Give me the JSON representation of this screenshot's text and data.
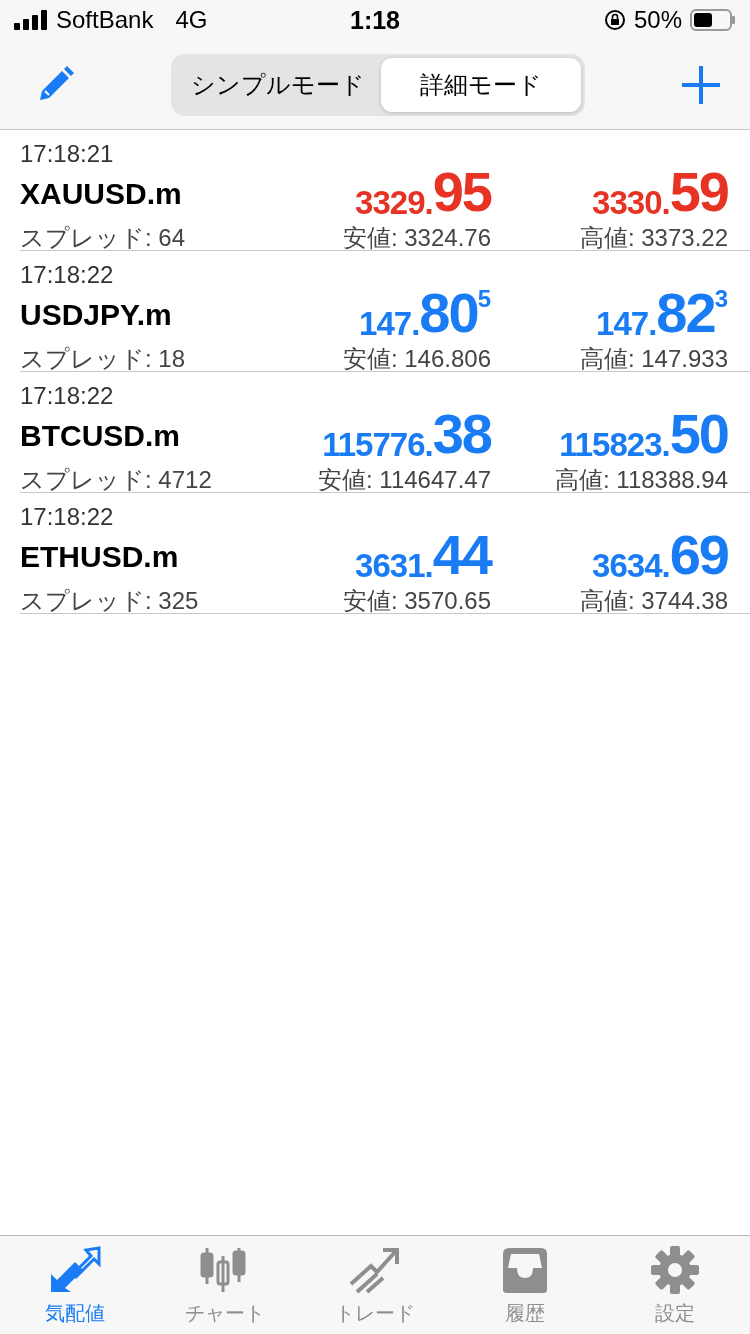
{
  "status_bar": {
    "carrier": "SoftBank",
    "network": "4G",
    "time": "1:18",
    "battery": "50%"
  },
  "segments": [
    {
      "label": "シンプルモード",
      "selected": false
    },
    {
      "label": "詳細モード",
      "selected": true
    }
  ],
  "quotes": [
    {
      "time": "17:18:21",
      "symbol": "XAUUSD.m",
      "spread": "スプレッド: 64",
      "color": "#e63323",
      "bid": {
        "small": "3329.",
        "big": "95"
      },
      "ask": {
        "small": "3330.",
        "big": "59"
      },
      "low": "安値: 3324.76",
      "high": "高値: 3373.22"
    },
    {
      "time": "17:18:22",
      "symbol": "USDJPY.m",
      "spread": "スプレッド: 18",
      "color": "#1a7cf5",
      "bid": {
        "small": "147.",
        "big": "80",
        "sup": "5"
      },
      "ask": {
        "small": "147.",
        "big": "82",
        "sup": "3"
      },
      "low": "安値: 146.806",
      "high": "高値: 147.933"
    },
    {
      "time": "17:18:22",
      "symbol": "BTCUSD.m",
      "spread": "スプレッド: 4712",
      "color": "#1a7cf5",
      "bid": {
        "small": "115776.",
        "big": "38"
      },
      "ask": {
        "small": "115823.",
        "big": "50"
      },
      "low": "安値: 114647.47",
      "high": "高値: 118388.94"
    },
    {
      "time": "17:18:22",
      "symbol": "ETHUSD.m",
      "spread": "スプレッド: 325",
      "color": "#1a7cf5",
      "bid": {
        "small": "3631.",
        "big": "44"
      },
      "ask": {
        "small": "3634.",
        "big": "69"
      },
      "low": "安値: 3570.65",
      "high": "高値: 3744.38"
    }
  ],
  "tab_bar": [
    {
      "kind": "quotes",
      "label": "気配値",
      "selected": true
    },
    {
      "kind": "chart",
      "label": "チャート",
      "selected": false
    },
    {
      "kind": "trade",
      "label": "トレード",
      "selected": false
    },
    {
      "kind": "history",
      "label": "履歴",
      "selected": false
    },
    {
      "kind": "settings",
      "label": "設定",
      "selected": false
    }
  ]
}
